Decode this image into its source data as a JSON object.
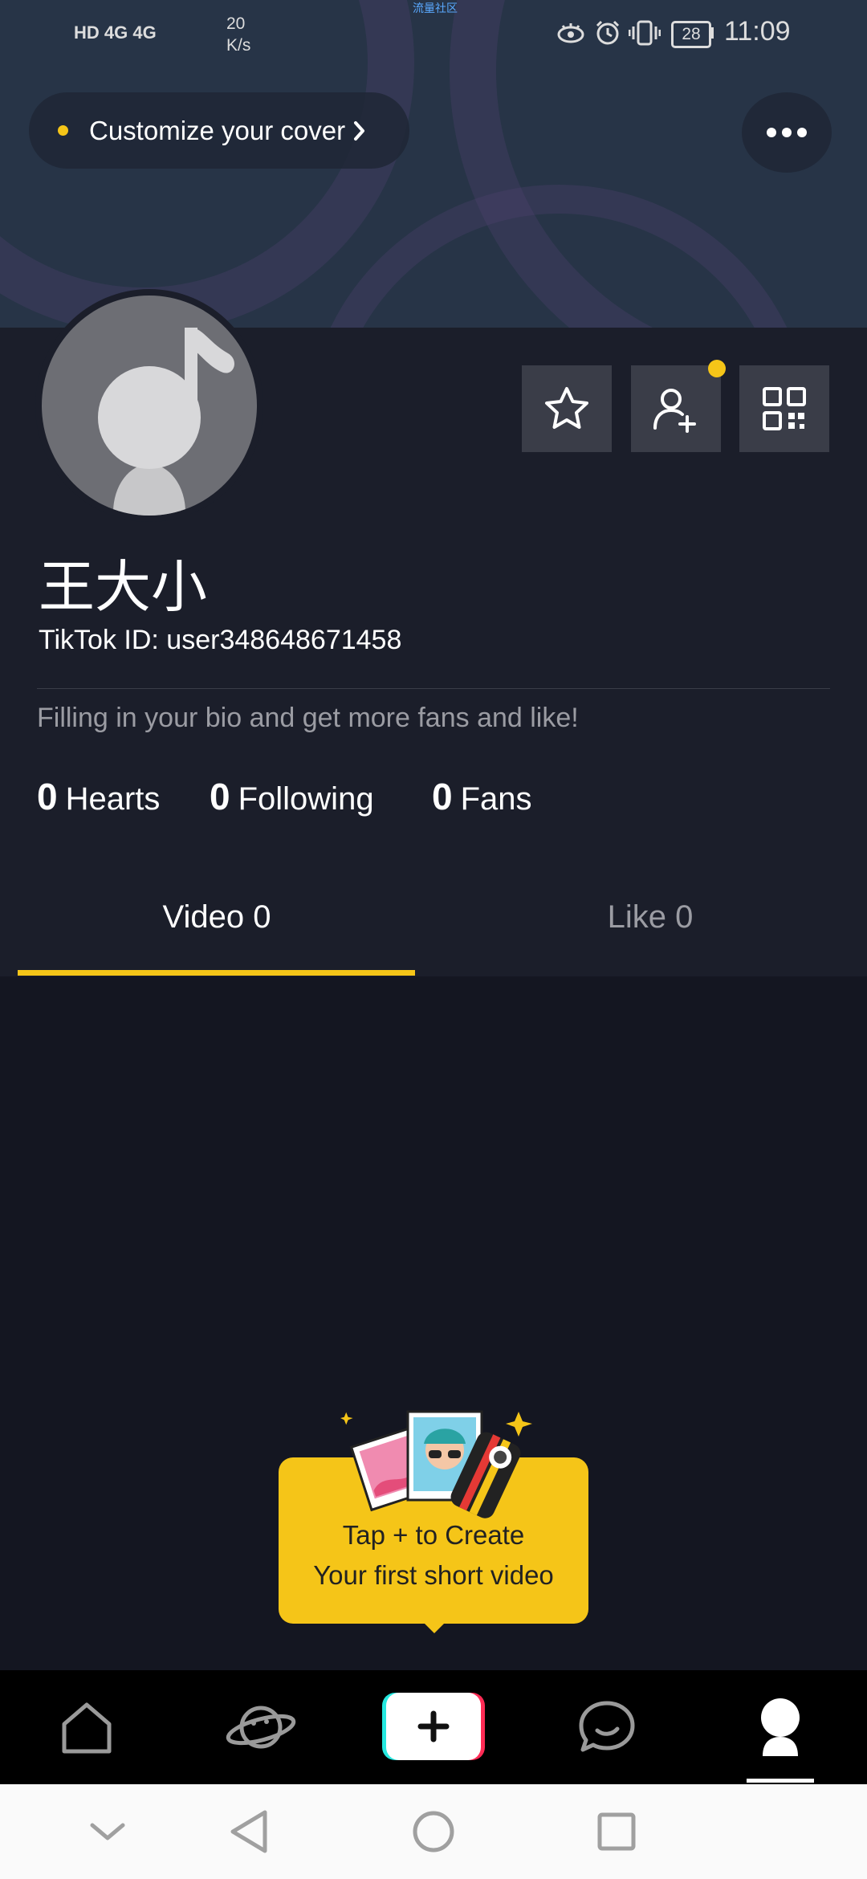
{
  "status_bar": {
    "left_indicators": "HD 4G 4G",
    "speed_value": "20",
    "speed_unit": "K/s",
    "battery": "28",
    "time": "11:09",
    "top_small_text": "流量社区"
  },
  "cover": {
    "customize_label": "Customize your cover"
  },
  "profile": {
    "name": "王大小",
    "tiktok_id": "TikTok ID: user348648671458",
    "bio_placeholder": "Filling in your bio and get more fans and like!",
    "stats": [
      {
        "value": "0",
        "label": "Hearts"
      },
      {
        "value": "0",
        "label": "Following"
      },
      {
        "value": "0",
        "label": "Fans"
      }
    ]
  },
  "tabs": [
    {
      "label": "Video 0",
      "active": true
    },
    {
      "label": "Like 0",
      "active": false
    }
  ],
  "tooltip": {
    "line1": "Tap + to Create",
    "line2": "Your first short video"
  },
  "bottom_nav": [
    {
      "icon": "home-icon"
    },
    {
      "icon": "discover-planet-icon"
    },
    {
      "icon": "plus-icon"
    },
    {
      "icon": "inbox-chat-icon"
    },
    {
      "icon": "profile-me-icon"
    }
  ],
  "colors": {
    "accent_yellow": "#f5c518",
    "background": "#141621",
    "profile_bg": "#1b1e2a",
    "cover_bg": "#273447"
  }
}
